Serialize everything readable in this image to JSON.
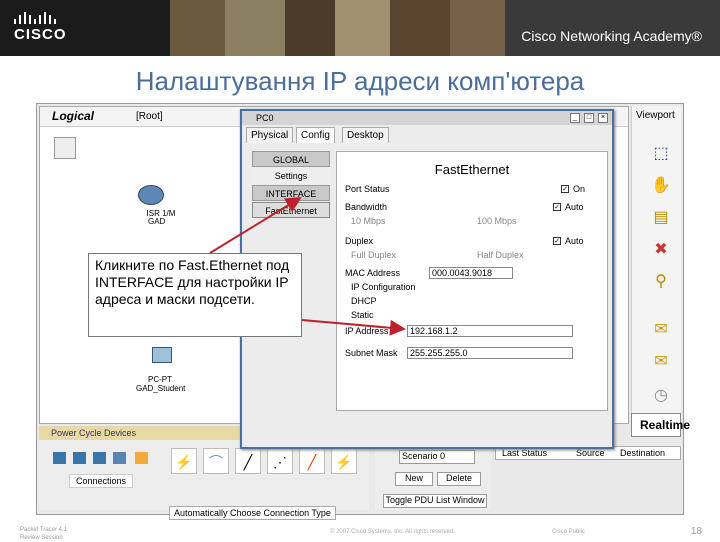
{
  "banner": {
    "logo_text": "CISCO",
    "academy_text": "Cisco Networking Academy®"
  },
  "slide": {
    "title": "Налаштування IP адреси комп'ютера"
  },
  "workspace": {
    "mode_label": "Logical",
    "root_label": "[Root]",
    "router_label": "ISR 1/M",
    "router_name": "GAD",
    "pc_label": "PC-PT",
    "pc_name": "GAD_Student"
  },
  "viewport": {
    "label": "Viewport"
  },
  "pc0": {
    "title": "PC0",
    "tabs": [
      {
        "label": "Physical"
      },
      {
        "label": "Config"
      },
      {
        "label": "Desktop"
      }
    ],
    "nav": [
      {
        "label": "GLOBAL"
      },
      {
        "label": "Settings"
      },
      {
        "label": "INTERFACE"
      },
      {
        "label": "FastEthernet"
      }
    ],
    "panel_title": "FastEthernet",
    "port_status_label": "Port Status",
    "port_on_label": "On",
    "bandwidth_label": "Bandwidth",
    "bw_auto_label": "Auto",
    "bw_10": "10 Mbps",
    "bw_100": "100 Mbps",
    "duplex_label": "Duplex",
    "duplex_auto_label": "Auto",
    "full_duplex": "Full Duplex",
    "half_duplex": "Half Duplex",
    "mac_label": "MAC Address",
    "mac_value": "000.0043.9018",
    "ip_config_label": "IP Configuration",
    "dhcp_label": "DHCP",
    "static_label": "Static",
    "ip_label": "IP Address",
    "ip_value": "192.168.1.2",
    "mask_label": "Subnet Mask",
    "mask_value": "255.255.255.0"
  },
  "callout": {
    "text": "Кликните по Fast.Ethernet под INTERFACE для настройки IP адреса и маски подсети."
  },
  "bottom": {
    "power_cycle": "Power Cycle Devices",
    "connections": "Connections",
    "auto_conn": "Automatically Choose Connection Type",
    "scenario": "Scenario 0",
    "new": "New",
    "delete": "Delete",
    "toggle_pdu": "Toggle PDU List Window",
    "realtime": "Realtime",
    "last_status": "Last Status",
    "source": "Source",
    "destination": "Destination"
  },
  "footer": {
    "left_line1": "Packet Tracer 4.1",
    "left_line2": "Review Session",
    "copyright": "© 2007 Cisco Systems, Inc. All rights reserved.",
    "public": "Cisco Public",
    "page": "18"
  },
  "colors": {
    "title": "#4a6d9a",
    "arrow": "#c0202a",
    "window_border": "#4d6f9e"
  }
}
